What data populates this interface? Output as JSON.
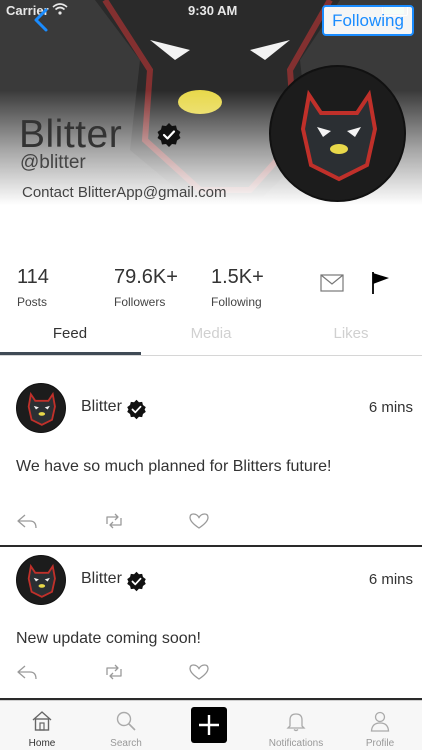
{
  "status_bar": {
    "carrier": "Carrier",
    "time": "9:30 AM"
  },
  "header": {
    "follow_label": "Following"
  },
  "profile": {
    "display_name": "Blitter",
    "handle": "@blitter",
    "contact": "Contact BlitterApp@gmail.com"
  },
  "stats": [
    {
      "value": "114",
      "label": "Posts"
    },
    {
      "value": "79.6K+",
      "label": "Followers"
    },
    {
      "value": "1.5K+",
      "label": "Following"
    }
  ],
  "tabs": [
    {
      "label": "Feed",
      "active": true
    },
    {
      "label": "Media",
      "active": false
    },
    {
      "label": "Likes",
      "active": false
    }
  ],
  "posts": [
    {
      "author": "Blitter",
      "time": "6 mins",
      "text": "We have so much planned for Blitters future!"
    },
    {
      "author": "Blitter",
      "time": "6 mins",
      "text": "New update coming soon!"
    }
  ],
  "tabbar": [
    {
      "label": "Home",
      "icon": "home-icon"
    },
    {
      "label": "Search",
      "icon": "search-icon"
    },
    {
      "label": "",
      "icon": "plus-icon"
    },
    {
      "label": "Notifications",
      "icon": "bell-icon"
    },
    {
      "label": "Profile",
      "icon": "person-icon"
    }
  ],
  "colors": {
    "accent": "#1a8cff",
    "tab_underline": "#3f4a55",
    "badge": "#111111"
  }
}
